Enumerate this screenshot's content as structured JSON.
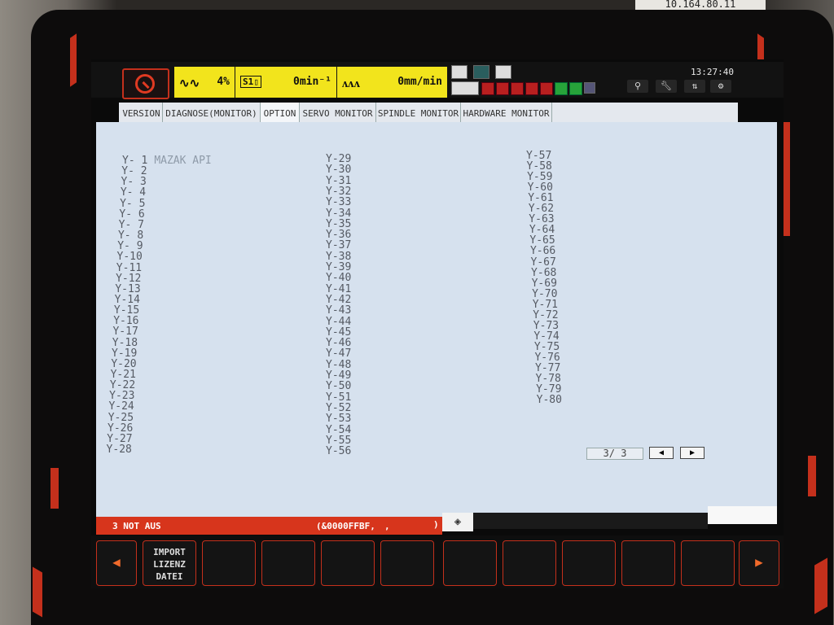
{
  "ip_label": "10.164.80.11",
  "status": {
    "override_pct": "4%",
    "spindle": "0min⁻¹",
    "feed": "0mm/min",
    "time": "13:27:40"
  },
  "tabs": [
    "VERSION",
    "DIAGNOSE(MONITOR)",
    "OPTION",
    "SERVO MONITOR",
    "SPINDLE MONITOR",
    "HARDWARE MONITOR"
  ],
  "col1": [
    "Y- 1",
    "Y- 2",
    "Y- 3",
    "Y- 4",
    "Y- 5",
    "Y- 6",
    "Y- 7",
    "Y- 8",
    "Y- 9",
    "Y-10",
    "Y-11",
    "Y-12",
    "Y-13",
    "Y-14",
    "Y-15",
    "Y-16",
    "Y-17",
    "Y-18",
    "Y-19",
    "Y-20",
    "Y-21",
    "Y-22",
    "Y-23",
    "Y-24",
    "Y-25",
    "Y-26",
    "Y-27",
    "Y-28"
  ],
  "col1_desc": "MAZAK API",
  "col2": [
    "Y-29",
    "Y-30",
    "Y-31",
    "Y-32",
    "Y-33",
    "Y-34",
    "Y-35",
    "Y-36",
    "Y-37",
    "Y-38",
    "Y-39",
    "Y-40",
    "Y-41",
    "Y-42",
    "Y-43",
    "Y-44",
    "Y-45",
    "Y-46",
    "Y-47",
    "Y-48",
    "Y-49",
    "Y-50",
    "Y-51",
    "Y-52",
    "Y-53",
    "Y-54",
    "Y-55",
    "Y-56"
  ],
  "col3": [
    "Y-57",
    "Y-58",
    "Y-59",
    "Y-60",
    "Y-61",
    "Y-62",
    "Y-63",
    "Y-64",
    "Y-65",
    "Y-66",
    "Y-67",
    "Y-68",
    "Y-69",
    "Y-70",
    "Y-71",
    "Y-72",
    "Y-73",
    "Y-74",
    "Y-75",
    "Y-76",
    "Y-77",
    "Y-78",
    "Y-79",
    "Y-80"
  ],
  "pager": "3/ 3",
  "alarm": {
    "message": "3 NOT AUS",
    "code": "(&0000FFBF,",
    "dot": ",",
    "close": ")"
  },
  "softkeys": {
    "left_arrow": "◀",
    "import": "IMPORT\nLIZENZ\nDATEI",
    "right_arrow": "▶"
  },
  "colors": {
    "accent": "#c4301c",
    "status_yellow": "#f2e41c",
    "panel": "#d6e1ee"
  }
}
